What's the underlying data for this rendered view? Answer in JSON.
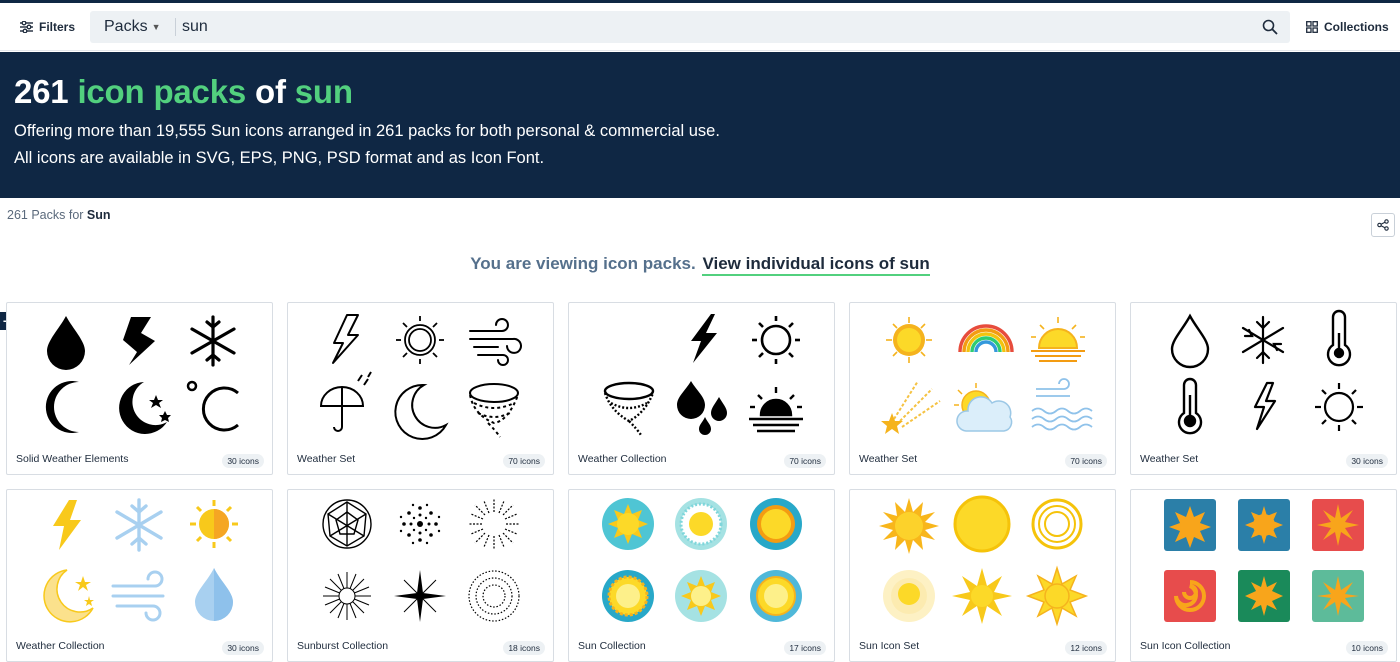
{
  "topbar": {
    "filters_label": "Filters",
    "search_type": "Packs",
    "search_value": "sun",
    "collections_label": "Collections"
  },
  "hero": {
    "count": "261",
    "middle": "icon packs",
    "of": "of",
    "term": "sun",
    "line1": "Offering more than 19,555 Sun icons arranged in 261 packs for both personal & commercial use.",
    "line2": "All icons are available in SVG, EPS, PNG, PSD format and as Icon Font."
  },
  "results": {
    "prefix": "261 Packs for",
    "term": "Sun"
  },
  "viewing": {
    "text": "You are viewing icon packs.",
    "link": "View individual icons of sun"
  },
  "colors": {
    "navy": "#0f2744",
    "green": "#52d07e"
  },
  "packs": [
    {
      "name": "Solid Weather Elements",
      "count": "30 icons"
    },
    {
      "name": "Weather Set",
      "count": "70 icons"
    },
    {
      "name": "Weather Collection",
      "count": "70 icons"
    },
    {
      "name": "Weather Set",
      "count": "70 icons"
    },
    {
      "name": "Weather Set",
      "count": "30 icons"
    },
    {
      "name": "Weather Collection",
      "count": "30 icons"
    },
    {
      "name": "Sunburst Collection",
      "count": "18 icons"
    },
    {
      "name": "Sun Collection",
      "count": "17 icons"
    },
    {
      "name": "Sun Icon Set",
      "count": "12 icons"
    },
    {
      "name": "Sun Icon Collection",
      "count": "10 icons"
    }
  ]
}
